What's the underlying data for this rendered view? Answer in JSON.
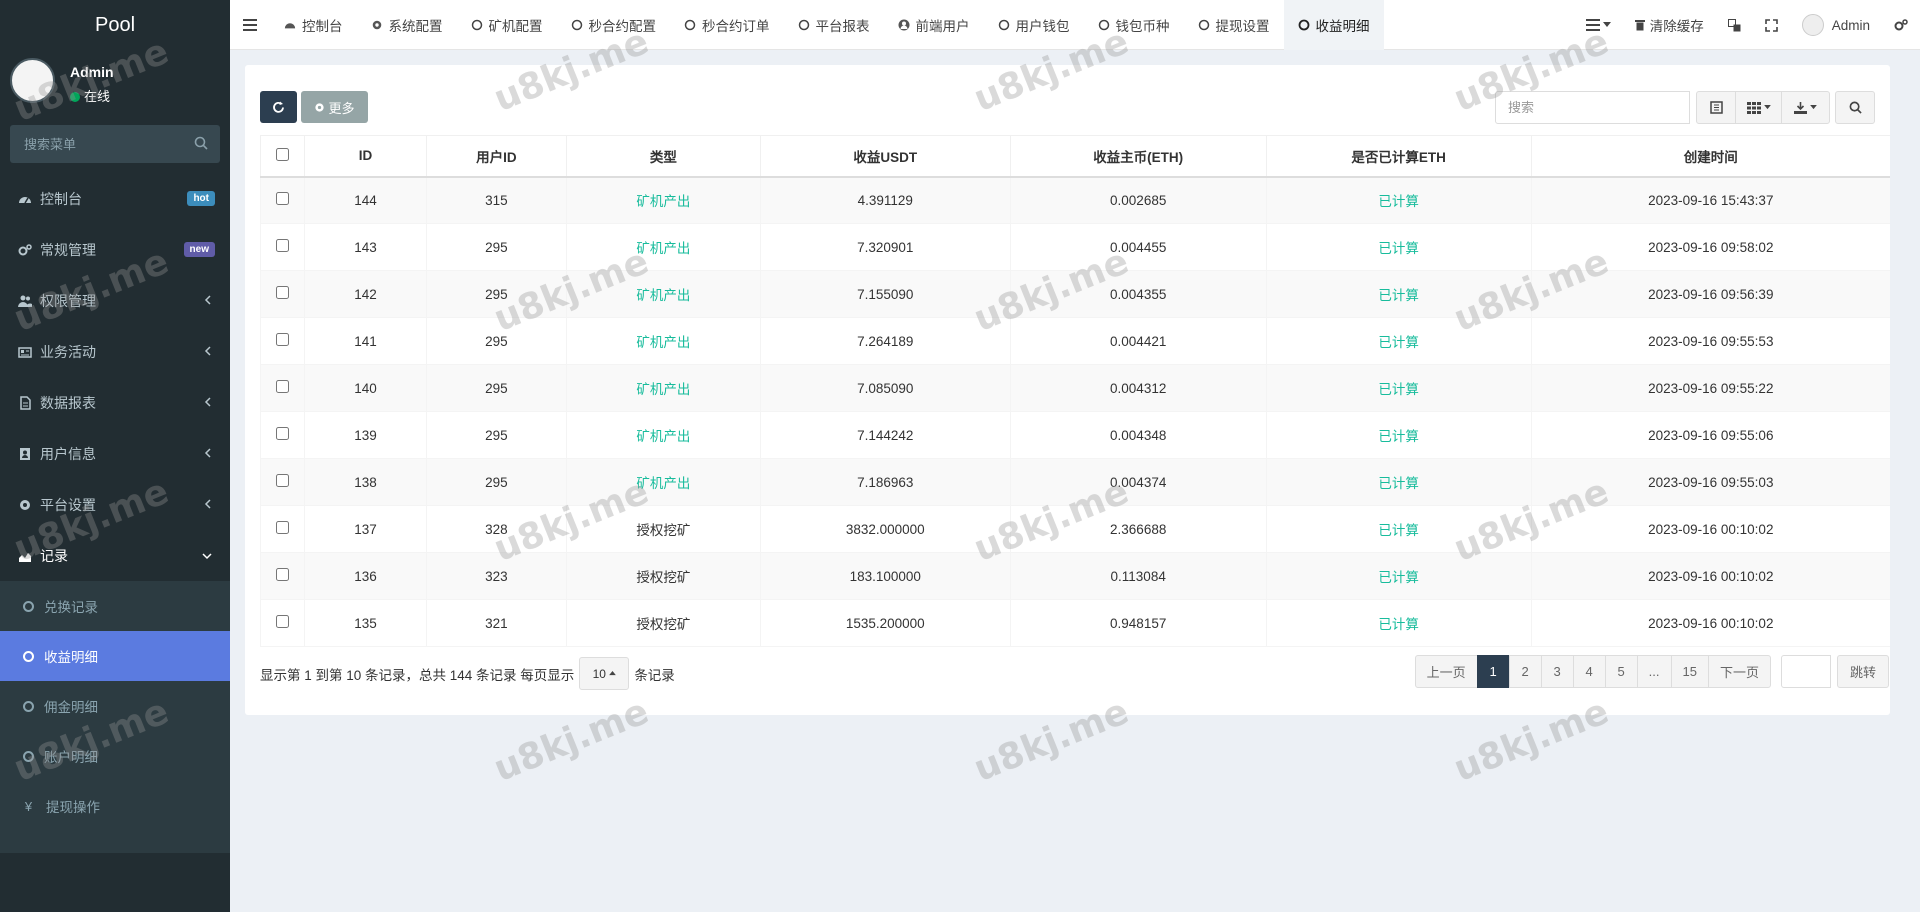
{
  "sidebar": {
    "logo": "Pool",
    "user": {
      "name": "Admin",
      "status": "在线"
    },
    "search_placeholder": "搜索菜单",
    "items": [
      {
        "label": "控制台",
        "icon": "dashboard-icon",
        "badge": "hot",
        "badge_color": "#3c8dbc"
      },
      {
        "label": "常规管理",
        "icon": "cogs-icon",
        "badge": "new",
        "badge_color": "#605ca8"
      },
      {
        "label": "权限管理",
        "icon": "group-icon"
      },
      {
        "label": "业务活动",
        "icon": "newspaper-icon"
      },
      {
        "label": "数据报表",
        "icon": "file-icon"
      },
      {
        "label": "用户信息",
        "icon": "address-book-icon"
      },
      {
        "label": "平台设置",
        "icon": "cog-icon"
      },
      {
        "label": "记录",
        "icon": "area-chart-icon"
      }
    ],
    "sub_items": [
      {
        "label": "兑换记录"
      },
      {
        "label": "收益明细",
        "active": true
      },
      {
        "label": "佣金明细"
      },
      {
        "label": "账户明细"
      },
      {
        "label": "提现操作",
        "icon": "yen-icon"
      }
    ]
  },
  "topbar": {
    "tabs": [
      {
        "label": "控制台",
        "icon": "dashboard-icon"
      },
      {
        "label": "系统配置",
        "icon": "gear-icon"
      },
      {
        "label": "矿机配置",
        "icon": "circle-icon"
      },
      {
        "label": "秒合约配置",
        "icon": "circle-icon"
      },
      {
        "label": "秒合约订单",
        "icon": "circle-icon"
      },
      {
        "label": "平台报表",
        "icon": "circle-icon"
      },
      {
        "label": "前端用户",
        "icon": "user-circle-icon"
      },
      {
        "label": "用户钱包",
        "icon": "circle-icon"
      },
      {
        "label": "钱包币种",
        "icon": "circle-icon"
      },
      {
        "label": "提现设置",
        "icon": "circle-icon"
      },
      {
        "label": "收益明细",
        "icon": "circle-icon",
        "active": true
      }
    ],
    "clear_cache": "清除缓存",
    "admin": "Admin"
  },
  "toolbar": {
    "more": "更多",
    "search_placeholder": "搜索"
  },
  "table": {
    "headers": [
      "ID",
      "用户ID",
      "类型",
      "收益USDT",
      "收益主币(ETH)",
      "是否已计算ETH",
      "创建时间"
    ],
    "rows": [
      {
        "id": "144",
        "uid": "315",
        "type": "矿机产出",
        "usdt": "4.391129",
        "eth": "0.002685",
        "calc": "已计算",
        "time": "2023-09-16 15:43:37"
      },
      {
        "id": "143",
        "uid": "295",
        "type": "矿机产出",
        "usdt": "7.320901",
        "eth": "0.004455",
        "calc": "已计算",
        "time": "2023-09-16 09:58:02"
      },
      {
        "id": "142",
        "uid": "295",
        "type": "矿机产出",
        "usdt": "7.155090",
        "eth": "0.004355",
        "calc": "已计算",
        "time": "2023-09-16 09:56:39"
      },
      {
        "id": "141",
        "uid": "295",
        "type": "矿机产出",
        "usdt": "7.264189",
        "eth": "0.004421",
        "calc": "已计算",
        "time": "2023-09-16 09:55:53"
      },
      {
        "id": "140",
        "uid": "295",
        "type": "矿机产出",
        "usdt": "7.085090",
        "eth": "0.004312",
        "calc": "已计算",
        "time": "2023-09-16 09:55:22"
      },
      {
        "id": "139",
        "uid": "295",
        "type": "矿机产出",
        "usdt": "7.144242",
        "eth": "0.004348",
        "calc": "已计算",
        "time": "2023-09-16 09:55:06"
      },
      {
        "id": "138",
        "uid": "295",
        "type": "矿机产出",
        "usdt": "7.186963",
        "eth": "0.004374",
        "calc": "已计算",
        "time": "2023-09-16 09:55:03"
      },
      {
        "id": "137",
        "uid": "328",
        "type": "授权挖矿",
        "usdt": "3832.000000",
        "eth": "2.366688",
        "calc": "已计算",
        "time": "2023-09-16 00:10:02"
      },
      {
        "id": "136",
        "uid": "323",
        "type": "授权挖矿",
        "usdt": "183.100000",
        "eth": "0.113084",
        "calc": "已计算",
        "time": "2023-09-16 00:10:02"
      },
      {
        "id": "135",
        "uid": "321",
        "type": "授权挖矿",
        "usdt": "1535.200000",
        "eth": "0.948157",
        "calc": "已计算",
        "time": "2023-09-16 00:10:02"
      }
    ]
  },
  "footer": {
    "info": "显示第 1 到第 10 条记录，总共 144 条记录 每页显示",
    "page_size": "10",
    "suffix": "条记录",
    "pages": [
      "上一页",
      "1",
      "2",
      "3",
      "4",
      "5",
      "...",
      "15",
      "下一页"
    ],
    "active_page": "1",
    "jump": "跳转"
  },
  "watermark": "u8kj.me",
  "colors": {
    "sidebar_bg": "#222d32",
    "active_sub": "#5b7be0",
    "green": "#18bc9c",
    "dark_btn": "#2c3e50"
  }
}
